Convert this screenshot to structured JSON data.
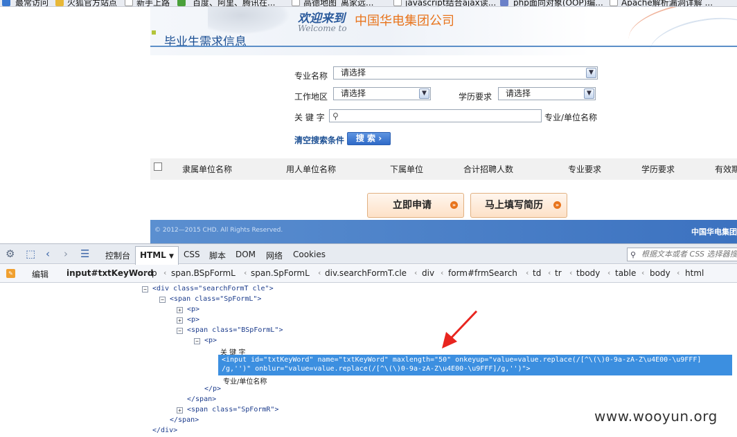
{
  "bookmarks": [
    {
      "label": "最常访问",
      "icon": "browser-icon",
      "color": "#3a78d0"
    },
    {
      "label": "火狐官方站点",
      "icon": "folder-icon",
      "color": "#e8b838"
    },
    {
      "label": "新手上路",
      "icon": "page-icon",
      "color": "#ffffff"
    },
    {
      "label": "百度、阿里、腾讯在...",
      "icon": "leaf-icon",
      "color": "#4aa03a"
    },
    {
      "label": "高德地图_离家远...",
      "icon": "page-icon",
      "color": "#ffffff"
    },
    {
      "label": "javascript结合ajax读...",
      "icon": "page-icon",
      "color": "#ffffff"
    },
    {
      "label": "php面向对象(OOP)编...",
      "icon": "php-icon",
      "color": "#6a80c8"
    },
    {
      "label": "Apache解析漏洞详解 ...",
      "icon": "page-icon",
      "color": "#ffffff"
    }
  ],
  "site": {
    "welcome": "欢迎来到",
    "welcome_en": "Welcome to",
    "company": "中国华电集团公司",
    "section_title": "毕业生需求信息"
  },
  "form": {
    "major_label": "专业名称",
    "major_value": "请选择",
    "region_label": "工作地区",
    "region_value": "请选择",
    "edu_label": "学历要求",
    "edu_value": "请选择",
    "keyword_label": "关 键 字",
    "keyword_value": "",
    "keyword_hint": "专业/单位名称",
    "clear_label": "清空搜索条件",
    "search_label": "搜 索"
  },
  "table": {
    "headers": [
      "隶属单位名称",
      "用人单位名称",
      "下属单位",
      "合计招聘人数",
      "专业要求",
      "学历要求",
      "有效期"
    ]
  },
  "actions": {
    "apply": "立即申请",
    "resume": "马上填写简历"
  },
  "footer": {
    "copyright": "© 2012—2015 CHD. All Rights Reserved.",
    "company": "中国华电集团"
  },
  "devtools": {
    "tabs": [
      "控制台",
      "HTML",
      "CSS",
      "脚本",
      "DOM",
      "网络",
      "Cookies"
    ],
    "active_tab": "HTML",
    "search_placeholder": "根据文本或者 CSS 选择器搜索",
    "edit_label": "编辑",
    "breadcrumbs": [
      "input#txtKeyWord",
      "p",
      "span.BSpFormL",
      "span.SpFormL",
      "div.searchFormT.cle",
      "div",
      "form#frmSearch",
      "td",
      "tr",
      "tbody",
      "table",
      "body",
      "html"
    ]
  },
  "tree": {
    "l1": "<div class=\"searchFormT cle\">",
    "l2": "<span class=\"SpFormL\">",
    "l3": "<p>",
    "l4": "<p>",
    "l5": "<span class=\"BSpFormL\">",
    "l6": "<p>",
    "l7": "关 键 字",
    "l8a": "<input id=\"txtKeyWord\" name=\"txtKeyWord\" maxlength=\"50\" onkeyup=\"value=value.replace(/[^\\(\\)0-9a-zA-Z\\u4E00-\\u9FFF]",
    "l8b": "/g,'')\" onblur=\"value=value.replace(/[^\\(\\)0-9a-zA-Z\\u4E00-\\u9FFF]/g,'')\">",
    "l9": "专业/单位名称",
    "l10": "</p>",
    "l11": "</span>",
    "l12": "<span class=\"SpFormR\">",
    "l13": "</span>",
    "l14": "</div>"
  },
  "watermark": "www.wooyun.org"
}
